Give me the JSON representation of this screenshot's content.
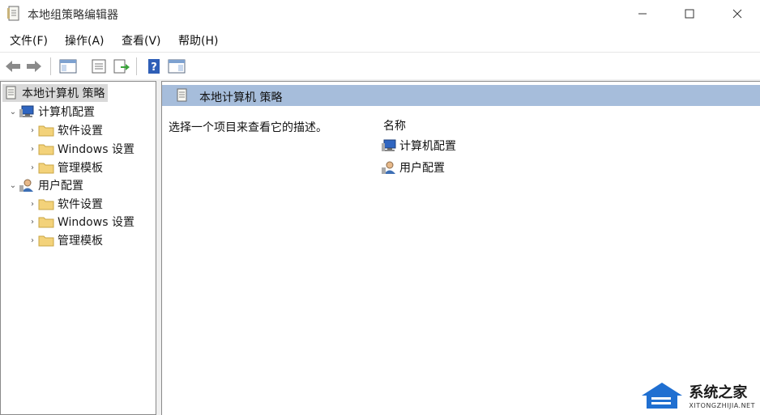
{
  "window": {
    "title": "本地组策略编辑器"
  },
  "menu": {
    "items": [
      {
        "label": "文件(F)"
      },
      {
        "label": "操作(A)"
      },
      {
        "label": "查看(V)"
      },
      {
        "label": "帮助(H)"
      }
    ]
  },
  "toolbar": {
    "icons": [
      "back-arrow-icon",
      "forward-arrow-icon",
      "show-hide-tree-icon",
      "properties-icon",
      "export-list-icon",
      "help-icon",
      "show-hide-action-pane-icon"
    ]
  },
  "tree": {
    "root": "本地计算机 策略",
    "computer": {
      "label": "计算机配置",
      "children": [
        "软件设置",
        "Windows 设置",
        "管理模板"
      ]
    },
    "user": {
      "label": "用户配置",
      "children": [
        "软件设置",
        "Windows 设置",
        "管理模板"
      ]
    }
  },
  "details": {
    "header": "本地计算机 策略",
    "description": "选择一个项目来查看它的描述。",
    "column_name": "名称",
    "items": [
      "计算机配置",
      "用户配置"
    ]
  },
  "watermark": {
    "main": "系统之家",
    "sub": "XITONGZHIJIA.NET"
  },
  "colors": {
    "header_band": "#a6bddb",
    "selection": "#d9d9d9",
    "folder": "#f3d27a",
    "help": "#2f5fb7"
  }
}
